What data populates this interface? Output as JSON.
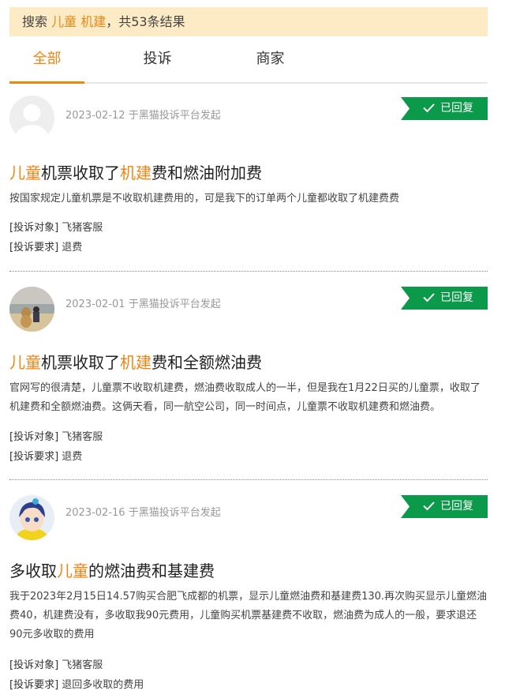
{
  "search": {
    "prefix": "搜索",
    "keyword": "儿童 机建",
    "suffix": "，共53条结果"
  },
  "tabs": [
    {
      "label": "全部",
      "active": true
    },
    {
      "label": "投诉",
      "active": false
    },
    {
      "label": "商家",
      "active": false
    }
  ],
  "accent_color": "#f08512",
  "badge_color": "#0a9a4a",
  "complaints": [
    {
      "avatar": "default-avatar",
      "date": "2023-02-12",
      "platform_text": "于黑猫投诉平台发起",
      "status": "已回复",
      "title_parts": [
        {
          "text": "儿童",
          "highlight": true
        },
        {
          "text": "机票收取了",
          "highlight": false
        },
        {
          "text": "机建",
          "highlight": true
        },
        {
          "text": "费和燃油附加费",
          "highlight": false
        }
      ],
      "description": "按国家规定儿童机票是不收取机建费用的，可是我下的订单两个儿童都收取了机建费费",
      "target_label": "[投诉对象]",
      "target_value": "飞猪客服",
      "request_label": "[投诉要求]",
      "request_value": "退费"
    },
    {
      "avatar": "photo-avatar",
      "date": "2023-02-01",
      "platform_text": "于黑猫投诉平台发起",
      "status": "已回复",
      "title_parts": [
        {
          "text": "儿童",
          "highlight": true
        },
        {
          "text": "机票收取了",
          "highlight": false
        },
        {
          "text": "机建",
          "highlight": true
        },
        {
          "text": "费和全额燃油费",
          "highlight": false
        }
      ],
      "description": "官网写的很清楚，儿童票不收取机建费，燃油费收取成人的一半，但是我在1月22日买的儿童票，收取了机建费和全额燃油费。这俩天看，同一航空公司，同一时间点，儿童票不收取机建费和燃油费。",
      "target_label": "[投诉对象]",
      "target_value": "飞猪客服",
      "request_label": "[投诉要求]",
      "request_value": "退费"
    },
    {
      "avatar": "cartoon-avatar",
      "date": "2023-02-16",
      "platform_text": "于黑猫投诉平台发起",
      "status": "已回复",
      "title_parts": [
        {
          "text": "多收取",
          "highlight": false
        },
        {
          "text": "儿童",
          "highlight": true
        },
        {
          "text": "的燃油费和基建费",
          "highlight": false
        }
      ],
      "description": "我于2023年2月15日14.57购买合肥飞成都的机票，显示儿童燃油费和基建费130.再次购买显示儿童燃油费40，机建费没有，多收取我90元费用，儿童购买机票基建费不收取，燃油费为成人的一般，要求退还90元多收取的费用",
      "target_label": "[投诉对象]",
      "target_value": "飞猪客服",
      "request_label": "[投诉要求]",
      "request_value": "退回多收取的费用"
    }
  ]
}
